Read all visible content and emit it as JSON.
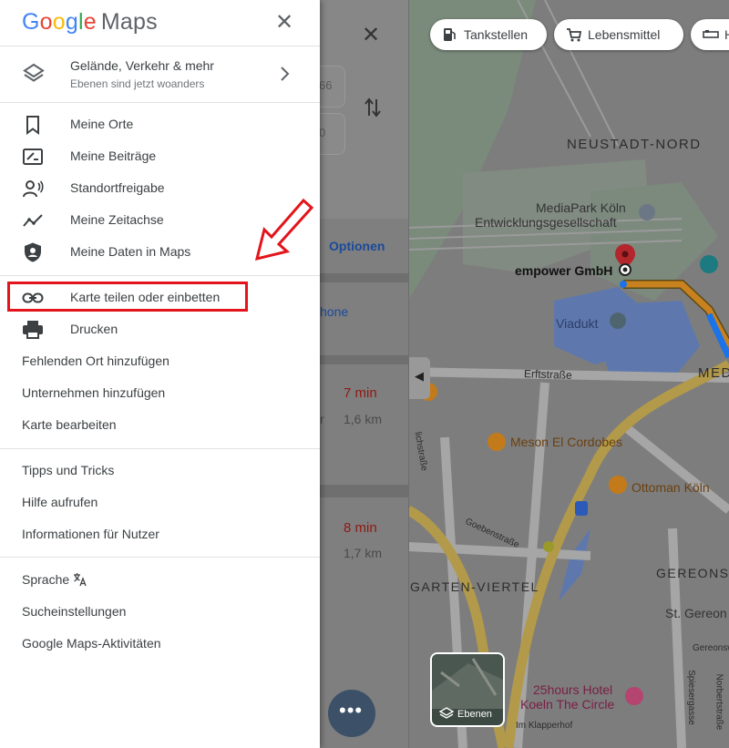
{
  "drawer": {
    "logo_google": "Google",
    "logo_maps": "Maps",
    "layers": {
      "title": "Gelände, Verkehr & mehr",
      "subtitle": "Ebenen sind jetzt woanders"
    },
    "section1": [
      {
        "label": "Meine Orte",
        "icon": "bookmark-icon"
      },
      {
        "label": "Meine Beiträge",
        "icon": "contributions-icon"
      },
      {
        "label": "Standortfreigabe",
        "icon": "location-sharing-icon"
      },
      {
        "label": "Meine Zeitachse",
        "icon": "timeline-icon"
      },
      {
        "label": "Meine Daten in Maps",
        "icon": "privacy-shield-icon"
      }
    ],
    "section2": [
      {
        "label": "Karte teilen oder einbetten",
        "icon": "link-icon"
      },
      {
        "label": "Drucken",
        "icon": "printer-icon"
      },
      {
        "label": "Fehlenden Ort hinzufügen"
      },
      {
        "label": "Unternehmen hinzufügen"
      },
      {
        "label": "Karte bearbeiten"
      }
    ],
    "section3": [
      {
        "label": "Tipps und Tricks"
      },
      {
        "label": "Hilfe aufrufen"
      },
      {
        "label": "Informationen für Nutzer"
      }
    ],
    "section4": [
      {
        "label": "Sprache",
        "icon": "translate-icon"
      },
      {
        "label": "Sucheinstellungen"
      },
      {
        "label": "Google Maps-Aktivitäten"
      }
    ]
  },
  "directions_panel": {
    "options_label": "Optionen",
    "phone_fragment": "hone",
    "input1_fragment": "66",
    "input2_fragment": "0",
    "routes": [
      {
        "time": "7 min",
        "distance": "1,6 km",
        "via_fragment": "r"
      },
      {
        "time": "8 min",
        "distance": "1,7 km"
      }
    ],
    "more_label": "•••"
  },
  "map": {
    "chips": [
      {
        "label": "Tankstellen",
        "icon": "gas-station-icon"
      },
      {
        "label": "Lebensmittel",
        "icon": "shopping-cart-icon"
      },
      {
        "label": "H",
        "icon": "hotel-icon"
      }
    ],
    "labels": {
      "neustadt_nord": "NEUSTADT-NORD",
      "mediapark_line1": "MediaPark Köln",
      "mediapark_line2": "Entwicklungsgesellschaft",
      "empower": "empower GmbH",
      "viadukt": "Viadukt",
      "erftstrasse": "Erftstraße",
      "med": "MED",
      "meson": "Meson El Cordobes",
      "ottoman": "Ottoman Köln",
      "garten": "GARTEN-VIERTEL",
      "gereons": "GEREONS",
      "st_gereon": "St. Gereon",
      "hotel_line1": "25hours Hotel",
      "hotel_line2": "Koeln The Circle",
      "klapperhof": "Im Klapperhof",
      "goebenstrasse": "Goebenstraße",
      "spiesergasse": "Spiesergasse",
      "norbertstrasse": "Norbertstraße",
      "gereonswall": "Gereonsw",
      "litchstrasse": "lichstraße"
    },
    "ebenen_label": "Ebenen"
  },
  "colors": {
    "highlight_red": "#e3141b",
    "google_blue": "#4285F4",
    "google_red": "#EA4335",
    "google_yellow": "#FBBC05",
    "google_green": "#34A853",
    "route_blue": "#1a73e8",
    "time_red": "#d93025"
  }
}
